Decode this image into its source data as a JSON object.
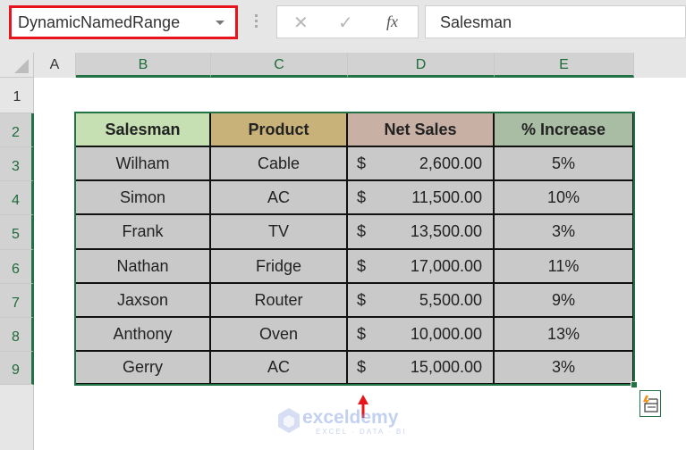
{
  "name_box": {
    "value": "DynamicNamedRange",
    "highlight_color": "#e8141c"
  },
  "formula_bar": {
    "cancel_icon": "✕",
    "enter_icon": "✓",
    "fx_label": "fx",
    "value": "Salesman"
  },
  "columns": [
    "A",
    "B",
    "C",
    "D",
    "E"
  ],
  "rows": [
    "1",
    "2",
    "3",
    "4",
    "5",
    "6",
    "7",
    "8",
    "9"
  ],
  "table": {
    "headers": [
      {
        "label": "Salesman",
        "color": "#c6e0b4"
      },
      {
        "label": "Product",
        "color": "#c9b27a"
      },
      {
        "label": "Net Sales",
        "color": "#c8b0a5"
      },
      {
        "label": "% Increase",
        "color": "#a9bca4"
      }
    ],
    "currency_symbol": "$",
    "rows": [
      {
        "salesman": "Wilham",
        "product": "Cable",
        "net_sales": "2,600.00",
        "increase": "5%"
      },
      {
        "salesman": "Simon",
        "product": "AC",
        "net_sales": "11,500.00",
        "increase": "10%"
      },
      {
        "salesman": "Frank",
        "product": "TV",
        "net_sales": "13,500.00",
        "increase": "3%"
      },
      {
        "salesman": "Nathan",
        "product": "Fridge",
        "net_sales": "17,000.00",
        "increase": "11%"
      },
      {
        "salesman": "Jaxson",
        "product": "Router",
        "net_sales": "5,500.00",
        "increase": "9%"
      },
      {
        "salesman": "Anthony",
        "product": "Oven",
        "net_sales": "10,000.00",
        "increase": "13%"
      },
      {
        "salesman": "Gerry",
        "product": "AC",
        "net_sales": "15,000.00",
        "increase": "3%"
      }
    ]
  },
  "selection_color": "#217346",
  "watermark": {
    "name": "exceldemy",
    "tagline": "EXCEL · DATA · BI"
  }
}
